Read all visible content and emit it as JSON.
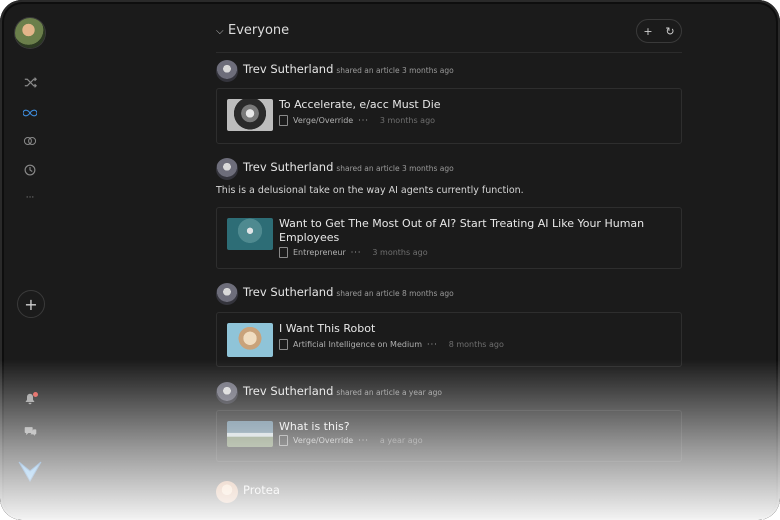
{
  "header": {
    "title": "Everyone",
    "add_glyph": "+",
    "refresh_glyph": "↻"
  },
  "sidebar": {
    "items": [
      {
        "name": "shuffle-icon",
        "glyph": "⤨"
      },
      {
        "name": "infinity-icon",
        "glyph": "∞"
      },
      {
        "name": "rings-icon",
        "glyph": "⊚"
      },
      {
        "name": "clock-icon",
        "glyph": "◷"
      },
      {
        "name": "more-icon",
        "glyph": "···"
      }
    ],
    "add_glyph": "+",
    "bell_glyph": "🔔",
    "chat_glyph": "💬"
  },
  "posts": [
    {
      "author": "Trev Sutherland",
      "action": "shared an article 3 months ago",
      "comment": "",
      "card": {
        "title": "To Accelerate, e/acc Must Die",
        "source": "Verge/Override",
        "dots": "···",
        "time": "3 months ago",
        "thumb": "dark-figure"
      }
    },
    {
      "author": "Trev Sutherland",
      "action": "shared an article 3 months ago",
      "comment": "This is a delusional take on the way AI agents currently function.",
      "card": {
        "title": "Want to Get The Most Out of AI? Start Treating AI Like Your Human Employees",
        "source": "Entrepreneur",
        "dots": "···",
        "time": "3 months ago",
        "thumb": "robot-teal"
      }
    },
    {
      "author": "Trev Sutherland",
      "action": "shared an article 8 months ago",
      "comment": "",
      "card": {
        "title": "I Want This Robot",
        "source": "Artificial Intelligence on Medium",
        "dots": "···",
        "time": "8 months ago",
        "thumb": "robot-sky"
      }
    },
    {
      "author": "Trev Sutherland",
      "action": "shared an article a year ago",
      "comment": "",
      "card": {
        "title": "What is this?",
        "source": "Verge/Override",
        "dots": "···",
        "time": "a year ago",
        "thumb": "landscape"
      }
    }
  ],
  "next_author": "Protea",
  "colors": {
    "accent": "#3e8ee0",
    "background": "#1b1b1b",
    "notification": "#e0524a"
  }
}
